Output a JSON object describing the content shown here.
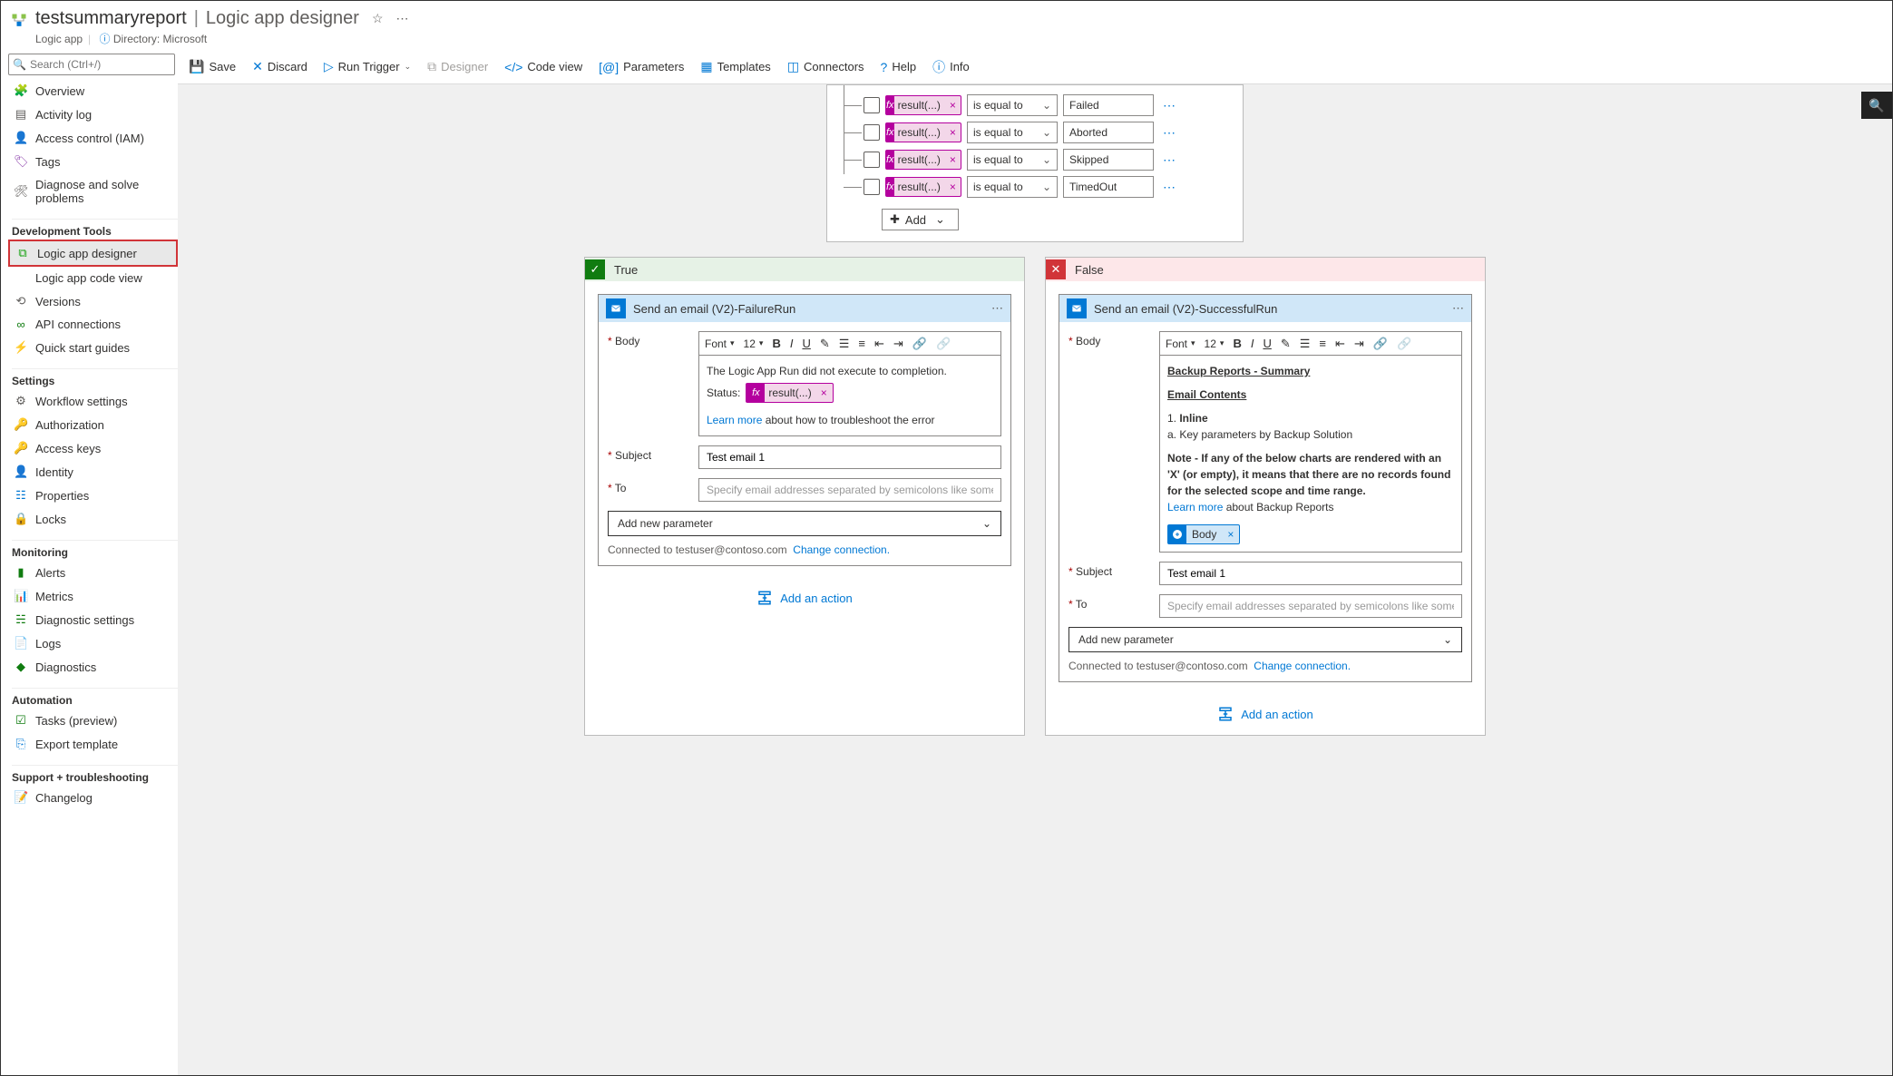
{
  "header": {
    "resource_name": "testsummaryreport",
    "designer_label": "Logic app designer",
    "subtitle_type": "Logic app",
    "directory_label": "Directory: Microsoft"
  },
  "search": {
    "placeholder": "Search (Ctrl+/)"
  },
  "nav": {
    "items_top": [
      {
        "label": "Overview",
        "icon": "🧩",
        "color": "#4caf50"
      },
      {
        "label": "Activity log",
        "icon": "▤",
        "color": "#605e5c"
      },
      {
        "label": "Access control (IAM)",
        "icon": "👤",
        "color": "#605e5c"
      },
      {
        "label": "Tags",
        "icon": "🏷",
        "color": "#8e44ad"
      },
      {
        "label": "Diagnose and solve problems",
        "icon": "🛠",
        "color": "#605e5c"
      }
    ],
    "section_dev": "Development Tools",
    "items_dev": [
      {
        "label": "Logic app designer",
        "icon": "⧉",
        "color": "#13a10e",
        "selected": true
      },
      {
        "label": "Logic app code view",
        "icon": "</>",
        "color": "#605e5c"
      },
      {
        "label": "Versions",
        "icon": "⟲",
        "color": "#605e5c"
      },
      {
        "label": "API connections",
        "icon": "∞",
        "color": "#107c10"
      },
      {
        "label": "Quick start guides",
        "icon": "⚡",
        "color": "#e3a21a"
      }
    ],
    "section_settings": "Settings",
    "items_settings": [
      {
        "label": "Workflow settings",
        "icon": "⚙",
        "color": "#605e5c"
      },
      {
        "label": "Authorization",
        "icon": "🔑",
        "color": "#e3a21a"
      },
      {
        "label": "Access keys",
        "icon": "🔑",
        "color": "#0078d4"
      },
      {
        "label": "Identity",
        "icon": "👤",
        "color": "#e3a21a"
      },
      {
        "label": "Properties",
        "icon": "☷",
        "color": "#0078d4"
      },
      {
        "label": "Locks",
        "icon": "🔒",
        "color": "#605e5c"
      }
    ],
    "section_monitoring": "Monitoring",
    "items_monitoring": [
      {
        "label": "Alerts",
        "icon": "▮",
        "color": "#107c10"
      },
      {
        "label": "Metrics",
        "icon": "📊",
        "color": "#0078d4"
      },
      {
        "label": "Diagnostic settings",
        "icon": "☵",
        "color": "#107c10"
      },
      {
        "label": "Logs",
        "icon": "📄",
        "color": "#0078d4"
      },
      {
        "label": "Diagnostics",
        "icon": "◆",
        "color": "#107c10"
      }
    ],
    "section_automation": "Automation",
    "items_automation": [
      {
        "label": "Tasks (preview)",
        "icon": "☑",
        "color": "#107c10"
      },
      {
        "label": "Export template",
        "icon": "⎘",
        "color": "#0078d4"
      }
    ],
    "section_support": "Support + troubleshooting",
    "items_support": [
      {
        "label": "Changelog",
        "icon": "📝",
        "color": "#0078d4"
      }
    ]
  },
  "toolbar": {
    "save": "Save",
    "discard": "Discard",
    "run": "Run Trigger",
    "designer": "Designer",
    "codeview": "Code view",
    "parameters": "Parameters",
    "templates": "Templates",
    "connectors": "Connectors",
    "help": "Help",
    "info": "Info"
  },
  "condition": {
    "token_label": "result(...)",
    "operator": "is equal to",
    "rows": [
      {
        "value": "Failed"
      },
      {
        "value": "Aborted"
      },
      {
        "value": "Skipped"
      },
      {
        "value": "TimedOut"
      }
    ],
    "add_label": "Add"
  },
  "branches": {
    "true_label": "True",
    "false_label": "False",
    "true_action": {
      "title": "Send an email (V2)-FailureRun",
      "body_label": "Body",
      "font_label": "Font",
      "size_label": "12",
      "body_text1": "The Logic App Run did not execute to completion.",
      "status_label": "Status:",
      "status_token": "result(...)",
      "learn_text": "Learn more",
      "learn_after": " about how to troubleshoot the error",
      "subject_label": "Subject",
      "subject_value": "Test email 1",
      "to_label": "To",
      "to_placeholder": "Specify email addresses separated by semicolons like someone@contoso.com",
      "param_label": "Add new parameter",
      "connected": "Connected to testuser@contoso.com",
      "change": "Change connection.",
      "add_action": "Add an action"
    },
    "false_action": {
      "title": "Send an email (V2)-SuccessfulRun",
      "body_label": "Body",
      "font_label": "Font",
      "size_label": "12",
      "heading": "Backup Reports - Summary",
      "subheading": "Email Contents",
      "line1": "1. Inline",
      "line2": "a. Key parameters by Backup Solution",
      "note": "Note - If any of the below charts are rendered with an 'X' (or empty), it means that there are no records found for the selected scope and time range.",
      "learn_text": "Learn more",
      "learn_after": " about Backup Reports",
      "body_token": "Body",
      "subject_label": "Subject",
      "subject_value": "Test email 1",
      "to_label": "To",
      "to_placeholder": "Specify email addresses separated by semicolons like someone@contoso.com",
      "param_label": "Add new parameter",
      "connected": "Connected to testuser@contoso.com",
      "change": "Change connection.",
      "add_action": "Add an action"
    }
  }
}
